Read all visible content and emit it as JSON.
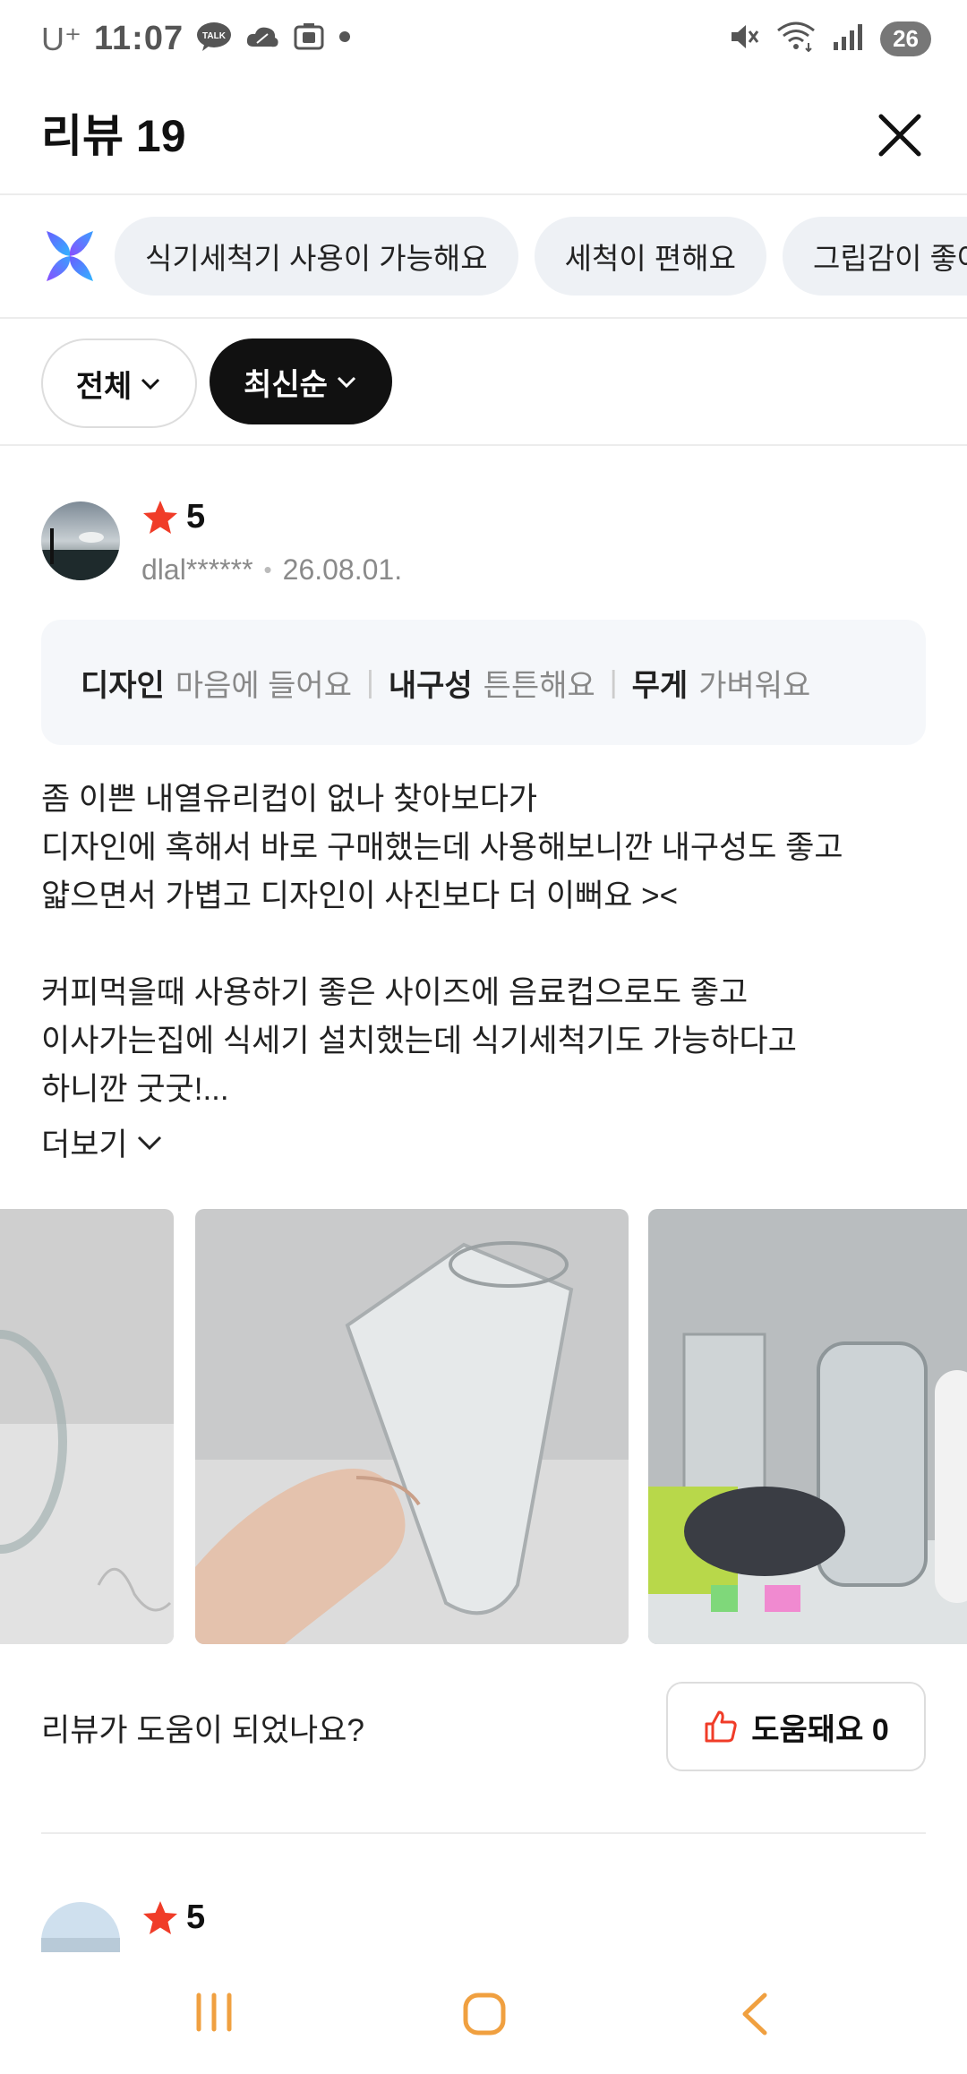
{
  "status": {
    "carrier": "U⁺",
    "time": "11:07",
    "battery": "26"
  },
  "header": {
    "title": "리뷰 19"
  },
  "chips": [
    {
      "label": "식기세척기 사용이 가능해요"
    },
    {
      "label": "세척이 편해요"
    },
    {
      "label": "그립감이 좋아요"
    }
  ],
  "filters": {
    "all_label": "전체",
    "sort_label": "최신순"
  },
  "review": {
    "rating": "5",
    "user": "dlal******",
    "date": "26.08.01.",
    "attributes": [
      {
        "key": "디자인",
        "value": "마음에 들어요"
      },
      {
        "key": "내구성",
        "value": "튼튼해요"
      },
      {
        "key": "무게",
        "value": "가벼워요"
      }
    ],
    "text_lines": [
      "좀 이쁜 내열유리컵이 없나 찾아보다가",
      "디자인에 혹해서 바로 구매했는데 사용해보니깐 내구성도 좋고",
      "얇으면서 가볍고 디자인이 사진보다 더 이뻐요 ><",
      "",
      "커피먹을때 사용하기 좋은 사이즈에 음료컵으로도 좋고",
      "이사가는집에 식세기 설치했는데 식기세척기도 가능하다고",
      "하니깐 굿굿!..."
    ],
    "more_label": "더보기",
    "helpful_question": "리뷰가 도움이 되었나요?",
    "helpful_button": "도움돼요 0"
  },
  "next_review": {
    "rating": "5"
  },
  "colors": {
    "star": "#f03c28",
    "sort_bg": "#111111",
    "chip_bg": "#eef1f5",
    "nav_icon": "#f0a040"
  }
}
